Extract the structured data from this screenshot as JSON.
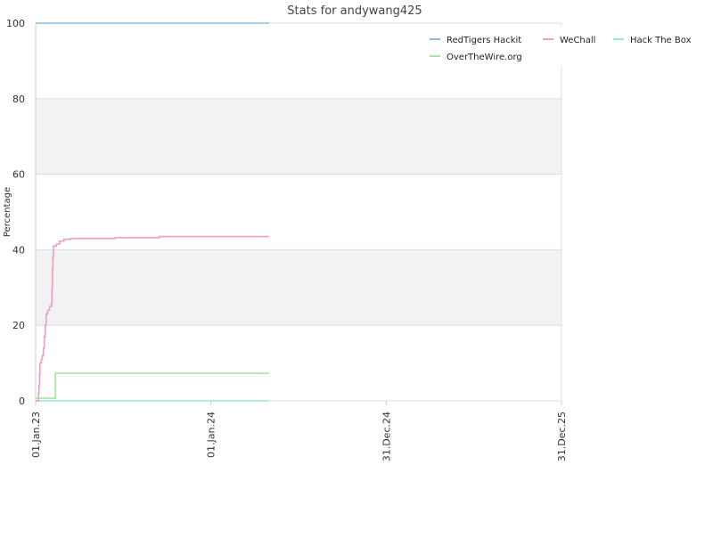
{
  "chart_data": {
    "type": "line",
    "title": "Stats for andywang425",
    "ylabel": "Percentage",
    "xlabel": "",
    "ylim": [
      0,
      100
    ],
    "y_ticks": [
      0,
      20,
      40,
      60,
      80,
      100
    ],
    "x_ticks": [
      "01.Jan.23",
      "01.Jan.24",
      "31.Dec.24",
      "31.Dec.25"
    ],
    "x_range": [
      "2023-01-01",
      "2025-12-31"
    ],
    "legend_position": "top-right",
    "grid": "alternating horizontal bands",
    "series": [
      {
        "name": "RedTigers Hackit",
        "color": "#88bde6",
        "points": [
          [
            "2023-01-01",
            100
          ],
          [
            "2024-05-01",
            100
          ]
        ]
      },
      {
        "name": "WeChall",
        "color": "#f19cc4",
        "points": [
          [
            "2023-01-01",
            0
          ],
          [
            "2023-01-06",
            0
          ],
          [
            "2023-01-07",
            2
          ],
          [
            "2023-01-08",
            4
          ],
          [
            "2023-01-09",
            7
          ],
          [
            "2023-01-10",
            10
          ],
          [
            "2023-01-13",
            11
          ],
          [
            "2023-01-15",
            12
          ],
          [
            "2023-01-17",
            14
          ],
          [
            "2023-01-19",
            17
          ],
          [
            "2023-01-21",
            20
          ],
          [
            "2023-01-23",
            23
          ],
          [
            "2023-01-26",
            24
          ],
          [
            "2023-01-30",
            25
          ],
          [
            "2023-02-03",
            26
          ],
          [
            "2023-02-04",
            30
          ],
          [
            "2023-02-05",
            35
          ],
          [
            "2023-02-06",
            38
          ],
          [
            "2023-02-07",
            41
          ],
          [
            "2023-02-13",
            41.5
          ],
          [
            "2023-02-20",
            42.3
          ],
          [
            "2023-03-01",
            42.8
          ],
          [
            "2023-03-15",
            43.0
          ],
          [
            "2023-06-15",
            43.0
          ],
          [
            "2023-06-16",
            43.2
          ],
          [
            "2023-09-15",
            43.2
          ],
          [
            "2023-09-16",
            43.5
          ],
          [
            "2024-05-01",
            43.5
          ]
        ]
      },
      {
        "name": "Hack The Box",
        "color": "#99ead4",
        "points": [
          [
            "2023-01-01",
            0
          ],
          [
            "2024-05-01",
            0
          ]
        ]
      },
      {
        "name": "OverTheWire.org",
        "color": "#a2e8a2",
        "points": [
          [
            "2023-01-01",
            0.7
          ],
          [
            "2023-02-10",
            0.7
          ],
          [
            "2023-02-11",
            7.3
          ],
          [
            "2024-05-01",
            7.3
          ]
        ]
      }
    ]
  }
}
